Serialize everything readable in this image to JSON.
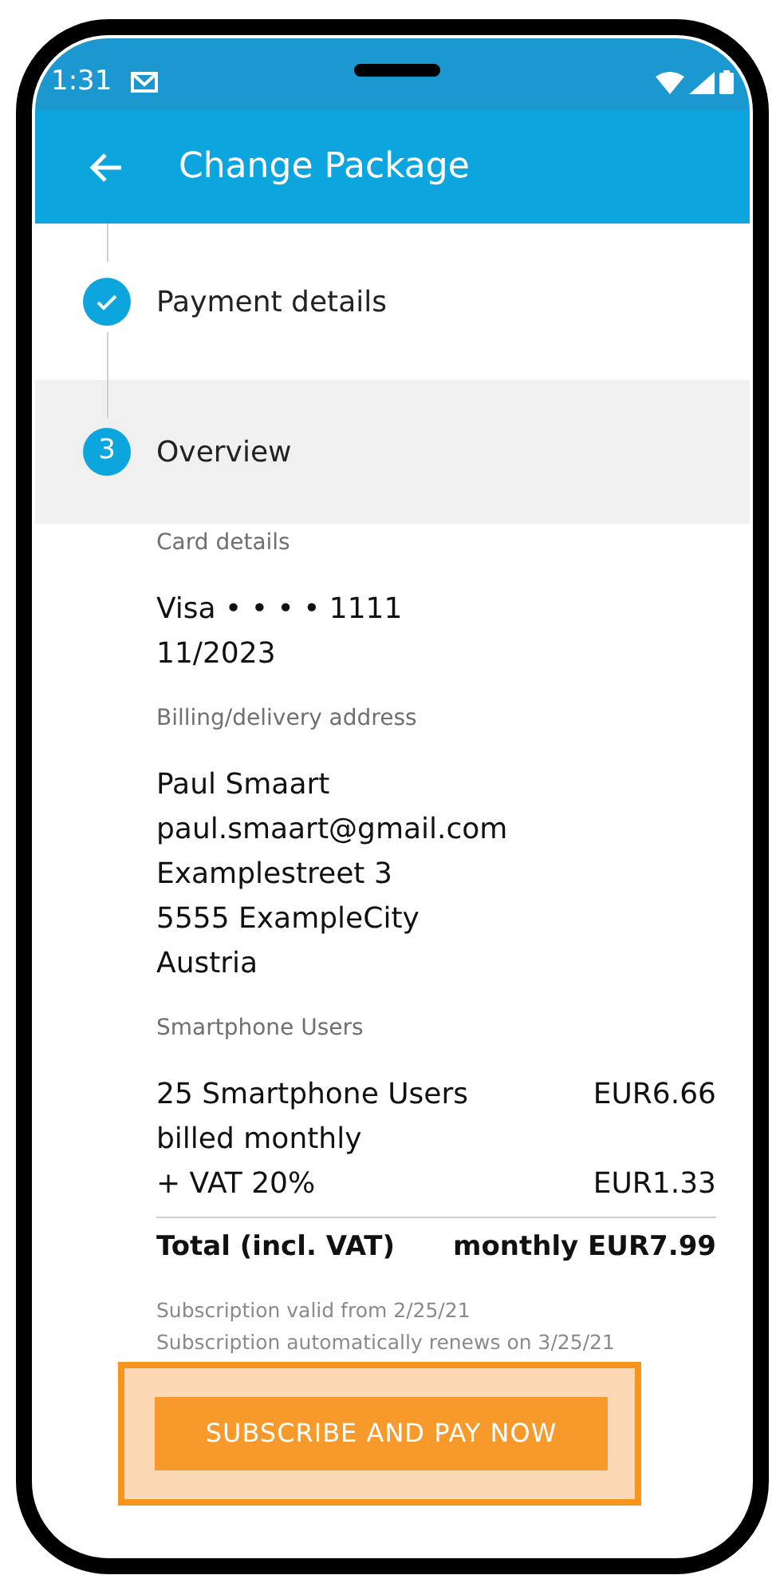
{
  "status_bar": {
    "time": "1:31"
  },
  "app_bar": {
    "title": "Change Package"
  },
  "steps": [
    {
      "label": "Payment details",
      "kind": "done",
      "selected": false
    },
    {
      "label": "Overview",
      "kind": "current",
      "number": "3",
      "selected": true
    }
  ],
  "sections": [
    {
      "heading": "Card details",
      "lines": [
        "Visa • • • • 1111",
        "11/2023"
      ]
    },
    {
      "heading": "Billing/delivery address",
      "lines": [
        "Paul Smaart",
        "paul.smaart@gmail.com",
        "Examplestreet 3",
        "5555 ExampleCity",
        "Austria"
      ]
    },
    {
      "heading": "Smartphone Users",
      "items": [
        {
          "label": "25 Smartphone Users",
          "amount": "EUR6.66"
        },
        {
          "label": "billed monthly"
        },
        {
          "label": "+ VAT 20%",
          "amount": "EUR1.33"
        }
      ],
      "total": {
        "label": "Total (incl. VAT)",
        "amount": "monthly EUR7.99"
      }
    }
  ],
  "notes": [
    "Subscription valid from 2/25/21",
    "Subscription automatically renews on 3/25/21"
  ],
  "primary_button": {
    "label": "SUBSCRIBE AND PAY NOW",
    "highlighted": true
  }
}
